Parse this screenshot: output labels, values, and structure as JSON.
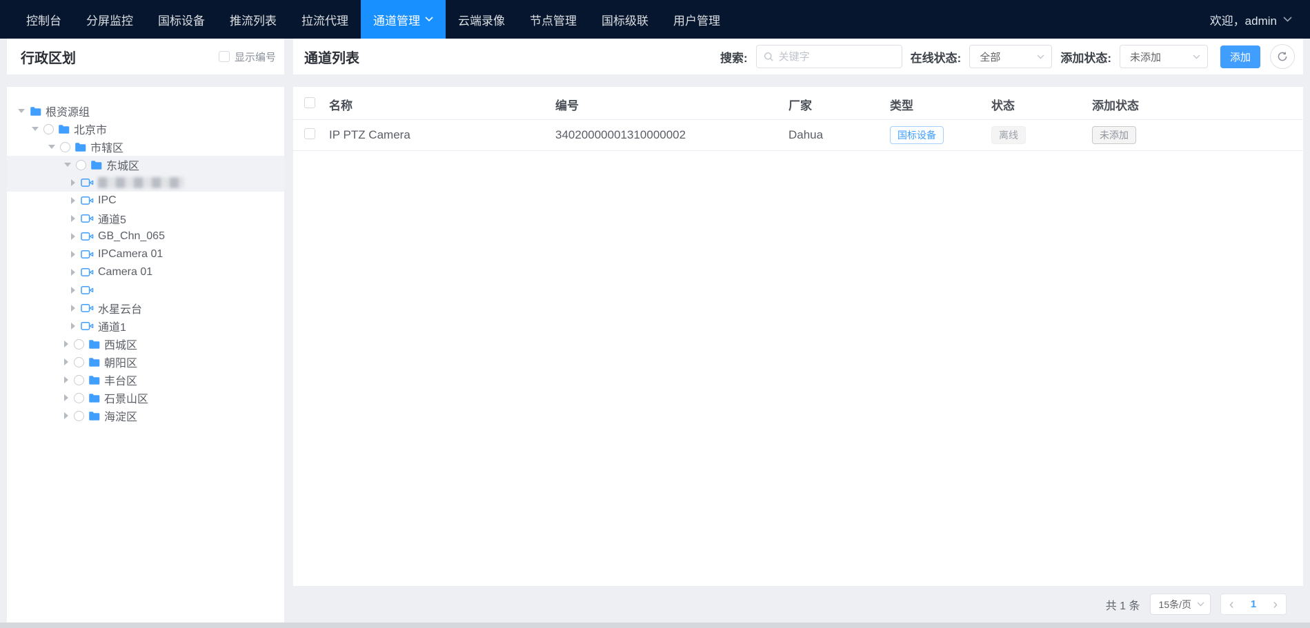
{
  "navbar": {
    "tabs": [
      {
        "label": "控制台",
        "active": false
      },
      {
        "label": "分屏监控",
        "active": false
      },
      {
        "label": "国标设备",
        "active": false
      },
      {
        "label": "推流列表",
        "active": false
      },
      {
        "label": "拉流代理",
        "active": false
      },
      {
        "label": "通道管理",
        "active": true
      },
      {
        "label": "云端录像",
        "active": false
      },
      {
        "label": "节点管理",
        "active": false
      },
      {
        "label": "国标级联",
        "active": false
      },
      {
        "label": "用户管理",
        "active": false
      }
    ],
    "welcome": "欢迎，admin"
  },
  "sidebar": {
    "title": "行政区划",
    "show_number_label": "显示编号",
    "tree": [
      {
        "level": 0,
        "kind": "folder",
        "caret": "down",
        "radio": false,
        "label": "根资源组",
        "highlighted": false,
        "blurred": false
      },
      {
        "level": 1,
        "kind": "folder",
        "caret": "down",
        "radio": true,
        "label": "北京市",
        "highlighted": false,
        "blurred": false
      },
      {
        "level": 2,
        "kind": "folder",
        "caret": "down",
        "radio": true,
        "label": "市辖区",
        "highlighted": false,
        "blurred": false
      },
      {
        "level": 3,
        "kind": "folder",
        "caret": "down",
        "radio": true,
        "label": "东城区",
        "highlighted": true,
        "blurred": false
      },
      {
        "level": 4,
        "kind": "camera",
        "caret": "right",
        "radio": false,
        "label": "",
        "highlighted": true,
        "blurred": true
      },
      {
        "level": 4,
        "kind": "camera",
        "caret": "right",
        "radio": false,
        "label": "IPC",
        "highlighted": false,
        "blurred": false
      },
      {
        "level": 4,
        "kind": "camera",
        "caret": "right",
        "radio": false,
        "label": "通道5",
        "highlighted": false,
        "blurred": false
      },
      {
        "level": 4,
        "kind": "camera",
        "caret": "right",
        "radio": false,
        "label": "GB_Chn_065",
        "highlighted": false,
        "blurred": false
      },
      {
        "level": 4,
        "kind": "camera",
        "caret": "right",
        "radio": false,
        "label": "IPCamera 01",
        "highlighted": false,
        "blurred": false
      },
      {
        "level": 4,
        "kind": "camera",
        "caret": "right",
        "radio": false,
        "label": "Camera 01",
        "highlighted": false,
        "blurred": false
      },
      {
        "level": 4,
        "kind": "camera",
        "caret": "right",
        "radio": false,
        "label": "",
        "highlighted": false,
        "blurred": false
      },
      {
        "level": 4,
        "kind": "camera",
        "caret": "right",
        "radio": false,
        "label": "水星云台",
        "highlighted": false,
        "blurred": false
      },
      {
        "level": 4,
        "kind": "camera",
        "caret": "right",
        "radio": false,
        "label": "通道1",
        "highlighted": false,
        "blurred": false
      },
      {
        "level": 3,
        "kind": "folder",
        "caret": "right",
        "radio": true,
        "label": "西城区",
        "highlighted": false,
        "blurred": false
      },
      {
        "level": 3,
        "kind": "folder",
        "caret": "right",
        "radio": true,
        "label": "朝阳区",
        "highlighted": false,
        "blurred": false
      },
      {
        "level": 3,
        "kind": "folder",
        "caret": "right",
        "radio": true,
        "label": "丰台区",
        "highlighted": false,
        "blurred": false
      },
      {
        "level": 3,
        "kind": "folder",
        "caret": "right",
        "radio": true,
        "label": "石景山区",
        "highlighted": false,
        "blurred": false
      },
      {
        "level": 3,
        "kind": "folder",
        "caret": "right",
        "radio": true,
        "label": "海淀区",
        "highlighted": false,
        "blurred": false
      }
    ]
  },
  "main": {
    "title": "通道列表",
    "filters": {
      "search_label": "搜索:",
      "search_placeholder": "关键字",
      "online_label": "在线状态:",
      "online_value": "全部",
      "add_label": "添加状态:",
      "add_value": "未添加",
      "add_button": "添加"
    },
    "table": {
      "headers": [
        "名称",
        "编号",
        "厂家",
        "类型",
        "状态",
        "添加状态"
      ],
      "rows": [
        {
          "name": "IP PTZ Camera",
          "code": "34020000001310000002",
          "vendor": "Dahua",
          "type": "国标设备",
          "status": "离线",
          "add_status": "未添加"
        }
      ]
    },
    "pagination": {
      "total_label": "共 1 条",
      "page_size": "15条/页",
      "prev": "‹",
      "current_page": "1",
      "next": "›"
    }
  },
  "colors": {
    "navbar_bg": "#06162e",
    "active_tab": "#1890ff",
    "accent_blue": "#409eff",
    "row_highlight": "#f0f2f5",
    "tag_gray_text": "#909399"
  }
}
